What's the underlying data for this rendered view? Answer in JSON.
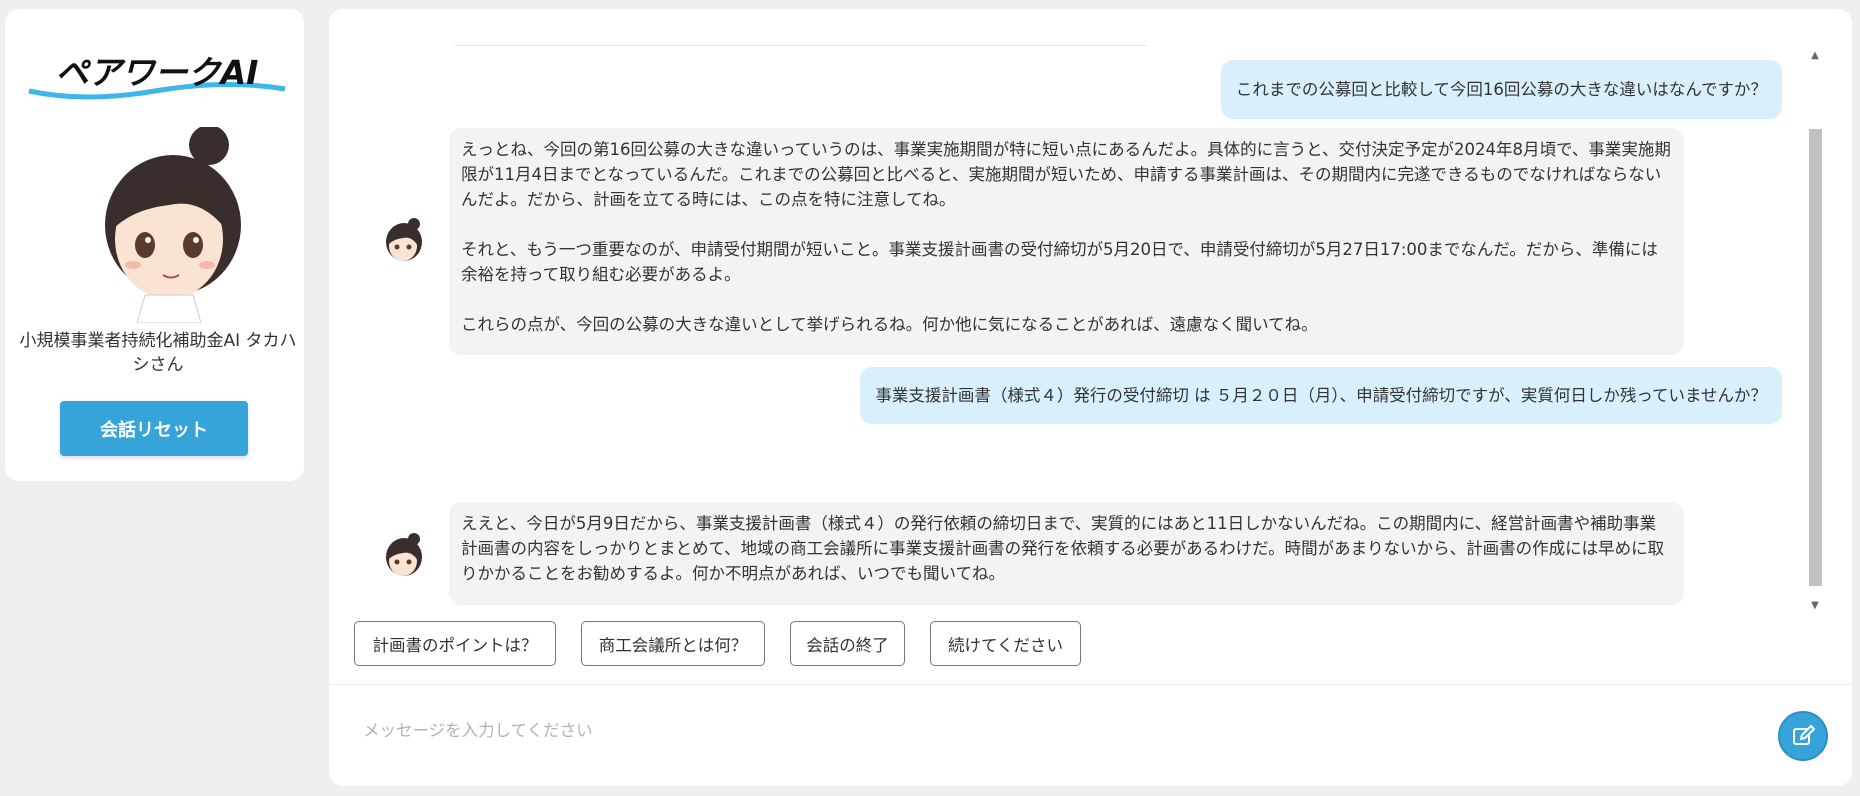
{
  "brand": {
    "logo_text": "ペアワークAI"
  },
  "sidebar": {
    "assistant_name": "小規模事業者持続化補助金AI タカハシさん",
    "reset_label": "会話リセット"
  },
  "colors": {
    "accent": "#36a3d9",
    "user_bubble": "#d8f0fb",
    "bot_bubble": "#f3f3f3"
  },
  "messages": [
    {
      "role": "user",
      "text": "これまでの公募回と比較して今回16回公募の大きな違いはなんですか？"
    },
    {
      "role": "bot",
      "paragraphs": [
        "えっとね、今回の第16回公募の大きな違いっていうのは、事業実施期間が特に短い点にあるんだよ。具体的に言うと、交付決定予定が2024年8月頃で、事業実施期限が11月4日までとなっているんだ。これまでの公募回と比べると、実施期間が短いため、申請する事業計画は、その期間内に完遂できるものでなければならないんだよ。だから、計画を立てる時には、この点を特に注意してね。",
        "それと、もう一つ重要なのが、申請受付期間が短いこと。事業支援計画書の受付締切が5月20日で、申請受付締切が5月27日17:00までなんだ。だから、準備には余裕を持って取り組む必要があるよ。",
        "これらの点が、今回の公募の大きな違いとして挙げられるね。何か他に気になることがあれば、遠慮なく聞いてね。"
      ]
    },
    {
      "role": "user",
      "text": "事業支援計画書（様式４）発行の受付締切 は ５月２０日（月）、申請受付締切ですが、実質何日しか残っていませんか？"
    },
    {
      "role": "bot",
      "paragraphs": [
        "ええと、今日が5月9日だから、事業支援計画書（様式４）の発行依頼の締切日まで、実質的にはあと11日しかないんだね。この期間内に、経営計画書や補助事業計画書の内容をしっかりとまとめて、地域の商工会議所に事業支援計画書の発行を依頼する必要があるわけだ。時間があまりないから、計画書の作成には早めに取りかかることをお勧めするよ。何か不明点があれば、いつでも聞いてね。"
      ]
    }
  ],
  "suggestions": [
    "計画書のポイントは？",
    "商工会議所とは何？",
    "会話の終了",
    "続けてください"
  ],
  "input": {
    "placeholder": "メッセージを入力してください",
    "value": ""
  },
  "icons": {
    "send": "edit-pen-icon",
    "scroll_up": "triangle-up-icon",
    "scroll_down": "triangle-down-icon"
  }
}
